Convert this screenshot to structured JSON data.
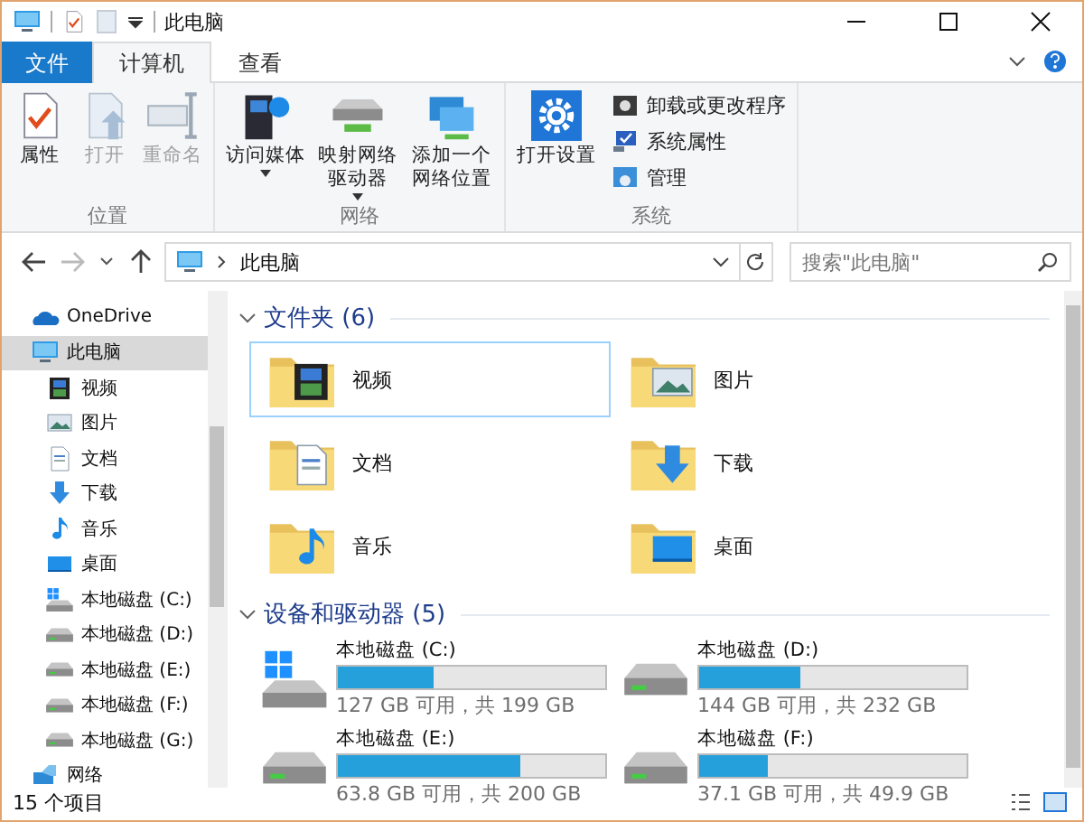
{
  "window": {
    "title": "此电脑"
  },
  "ribbon_tabs": [
    {
      "label": "文件",
      "kind": "file",
      "selected": false
    },
    {
      "label": "计算机",
      "kind": "tab",
      "selected": true
    },
    {
      "label": "查看",
      "kind": "tab",
      "selected": false
    }
  ],
  "ribbon_groups": [
    {
      "label": "位置",
      "buttons": [
        {
          "label": "属性",
          "kind": "props",
          "disabled": false,
          "dropdown": false
        },
        {
          "label": "打开",
          "kind": "open",
          "disabled": true,
          "dropdown": false
        },
        {
          "label": "重命名",
          "kind": "rename",
          "disabled": true,
          "dropdown": false
        }
      ]
    },
    {
      "label": "网络",
      "buttons": [
        {
          "label": "访问媒体",
          "kind": "media",
          "disabled": false,
          "dropdown": true
        },
        {
          "label": "映射网络驱动器",
          "kind": "mapdrive",
          "disabled": false,
          "dropdown": true
        },
        {
          "label": "添加一个网络位置",
          "kind": "addnet",
          "disabled": false,
          "dropdown": false
        }
      ]
    },
    {
      "label": "系统",
      "buttons": [
        {
          "label": "打开设置",
          "kind": "gear",
          "disabled": false,
          "dropdown": false
        }
      ],
      "small_buttons": [
        {
          "label": "卸载或更改程序",
          "kind": "uninstall"
        },
        {
          "label": "系统属性",
          "kind": "sysprops"
        },
        {
          "label": "管理",
          "kind": "manage"
        }
      ]
    }
  ],
  "address": {
    "path": "此电脑"
  },
  "search": {
    "placeholder": "搜索\"此电脑\""
  },
  "sidebar": {
    "items": [
      {
        "label": "OneDrive",
        "kind": "onedrive",
        "selected": false
      },
      {
        "label": "此电脑",
        "kind": "pc",
        "selected": true,
        "children": [
          {
            "label": "视频",
            "kind": "video",
            "selected": false
          },
          {
            "label": "图片",
            "kind": "pictures",
            "selected": false
          },
          {
            "label": "文档",
            "kind": "documents",
            "selected": false
          },
          {
            "label": "下载",
            "kind": "downloads",
            "selected": false
          },
          {
            "label": "音乐",
            "kind": "music",
            "selected": false
          },
          {
            "label": "桌面",
            "kind": "desktop",
            "selected": false
          },
          {
            "label": "本地磁盘 (C:)",
            "kind": "drivewin",
            "selected": false
          },
          {
            "label": "本地磁盘 (D:)",
            "kind": "drive",
            "selected": false
          },
          {
            "label": "本地磁盘 (E:)",
            "kind": "drive",
            "selected": false
          },
          {
            "label": "本地磁盘 (F:)",
            "kind": "drive",
            "selected": false
          },
          {
            "label": "本地磁盘 (G:)",
            "kind": "drive",
            "selected": false
          }
        ]
      },
      {
        "label": "网络",
        "kind": "network",
        "selected": false
      }
    ]
  },
  "folders": {
    "heading": "文件夹 (6)",
    "items": [
      {
        "label": "视频",
        "kind": "video",
        "selected": true
      },
      {
        "label": "图片",
        "kind": "pictures",
        "selected": false
      },
      {
        "label": "文档",
        "kind": "documents",
        "selected": false
      },
      {
        "label": "下载",
        "kind": "downloads",
        "selected": false
      },
      {
        "label": "音乐",
        "kind": "music",
        "selected": false
      },
      {
        "label": "桌面",
        "kind": "desktop",
        "selected": false
      }
    ]
  },
  "drives": {
    "heading": "设备和驱动器 (5)",
    "items": [
      {
        "label": "本地磁盘 (C:)",
        "kind": "drivewin",
        "level": 0.36,
        "space": "127 GB 可用，共 199 GB"
      },
      {
        "label": "本地磁盘 (D:)",
        "kind": "drive",
        "level": 0.38,
        "space": "144 GB 可用，共 232 GB"
      },
      {
        "label": "本地磁盘 (E:)",
        "kind": "drive",
        "level": 0.68,
        "space": "63.8 GB 可用，共 200 GB"
      },
      {
        "label": "本地磁盘 (F:)",
        "kind": "drive",
        "level": 0.26,
        "space": "37.1 GB 可用，共 49.9 GB"
      }
    ]
  },
  "status_bar": {
    "count": "15 个项目"
  }
}
